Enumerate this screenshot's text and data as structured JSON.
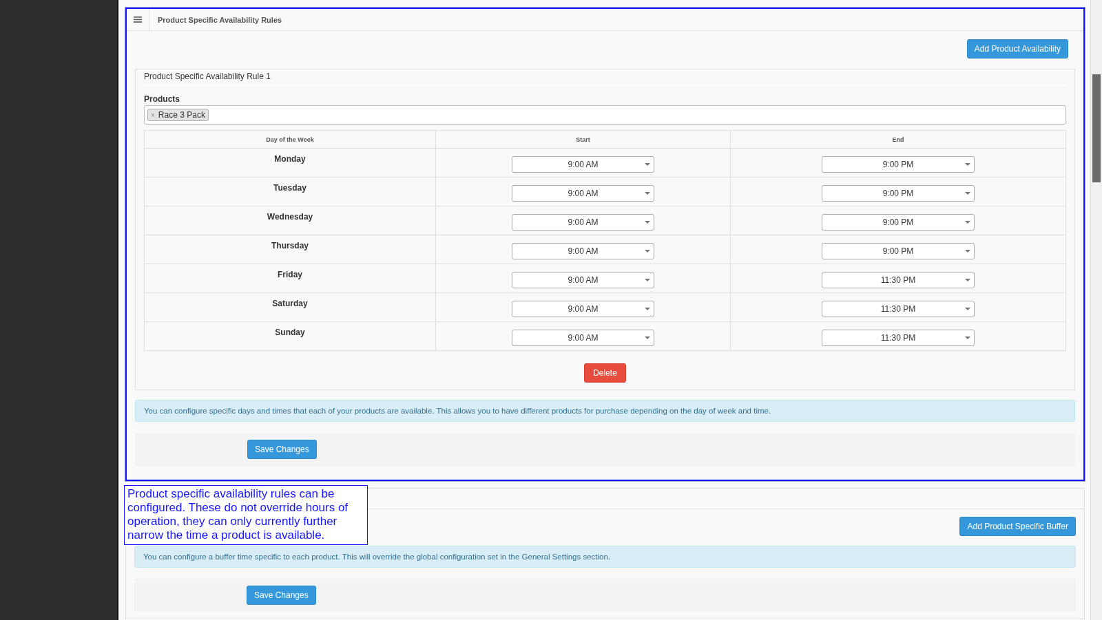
{
  "availability_panel": {
    "title": "Product Specific Availability Rules",
    "add_button": "Add Product Availability",
    "rules": [
      {
        "title": "Product Specific Availability Rule 1",
        "products_label": "Products",
        "products": [
          {
            "label": "Race 3 Pack",
            "remove": "×"
          }
        ],
        "columns": [
          "Day of the Week",
          "Start",
          "End"
        ],
        "rows": [
          {
            "day": "Monday",
            "start": "9:00 AM",
            "end": "9:00 PM"
          },
          {
            "day": "Tuesday",
            "start": "9:00 AM",
            "end": "9:00 PM"
          },
          {
            "day": "Wednesday",
            "start": "9:00 AM",
            "end": "9:00 PM"
          },
          {
            "day": "Thursday",
            "start": "9:00 AM",
            "end": "9:00 PM"
          },
          {
            "day": "Friday",
            "start": "9:00 AM",
            "end": "11:30 PM"
          },
          {
            "day": "Saturday",
            "start": "9:00 AM",
            "end": "11:30 PM"
          },
          {
            "day": "Sunday",
            "start": "9:00 AM",
            "end": "11:30 PM"
          }
        ],
        "delete_button": "Delete"
      }
    ],
    "info": "You can configure specific days and times that each of your products are available. This allows you to have different products for purchase depending on the day of week and time.",
    "save_button": "Save Changes"
  },
  "callout": {
    "text": "Product specific availability rules can be configured. These do not override hours of operation, they can only currently further narrow the time a product is available."
  },
  "buffer_panel": {
    "add_button": "Add Product Specific Buffer",
    "info": "You can configure a buffer time specific to each product. This will override the global configuration set in the General Settings section.",
    "save_button": "Save Changes"
  }
}
